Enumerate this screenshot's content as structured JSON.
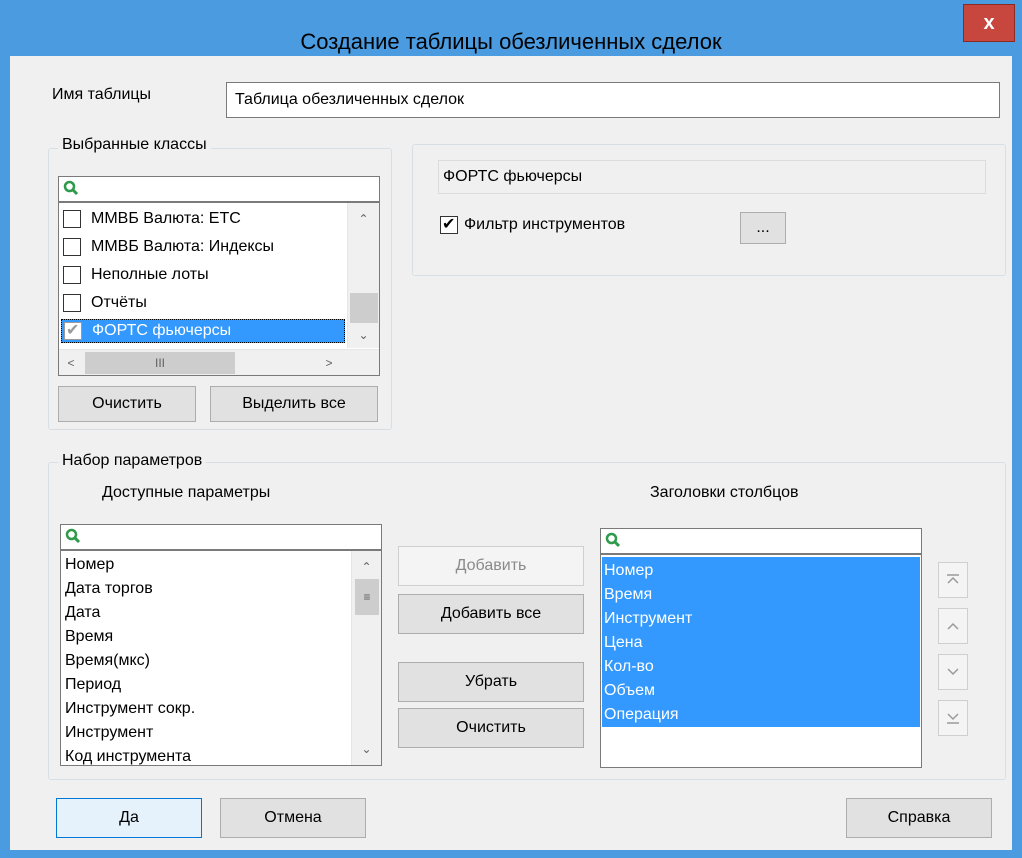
{
  "window": {
    "title": "Создание таблицы обезличенных сделок",
    "close_label": "x"
  },
  "table_name": {
    "label": "Имя таблицы",
    "value": "Таблица обезличенных сделок"
  },
  "classes": {
    "group_title": "Выбранные классы",
    "items": [
      {
        "label": "ММВБ Валюта: ETC",
        "checked": false
      },
      {
        "label": "ММВБ Валюта: Индексы",
        "checked": false
      },
      {
        "label": "Неполные лоты",
        "checked": false
      },
      {
        "label": "Отчёты",
        "checked": false
      },
      {
        "label": "ФОРТС фьючерсы",
        "checked": true
      }
    ],
    "clear_button": "Очистить",
    "select_all_button": "Выделить все",
    "hscroll_thumb": "III"
  },
  "class_details": {
    "selected_class": "ФОРТС фьючерсы",
    "filter_label": "Фильтр инструментов",
    "filter_checked": true,
    "more_button": "..."
  },
  "params": {
    "group_title": "Набор параметров",
    "available_title": "Доступные параметры",
    "columns_title": "Заголовки столбцов",
    "available": [
      "Номер",
      "Дата торгов",
      "Дата",
      "Время",
      "Время(мкс)",
      "Период",
      "Инструмент сокр.",
      "Инструмент",
      "Код инструмента"
    ],
    "columns": [
      "Номер",
      "Время",
      "Инструмент",
      "Цена",
      "Кол-во",
      "Объем",
      "Операция"
    ],
    "add_button": "Добавить",
    "add_all_button": "Добавить все",
    "remove_button": "Убрать",
    "clear_button": "Очистить"
  },
  "footer": {
    "ok_button": "Да",
    "cancel_button": "Отмена",
    "help_button": "Справка"
  },
  "colors": {
    "title_bar": "#4a9be0",
    "close_button": "#c7463e",
    "selection": "#3399ff",
    "search_icon": "#2e9a4a"
  }
}
